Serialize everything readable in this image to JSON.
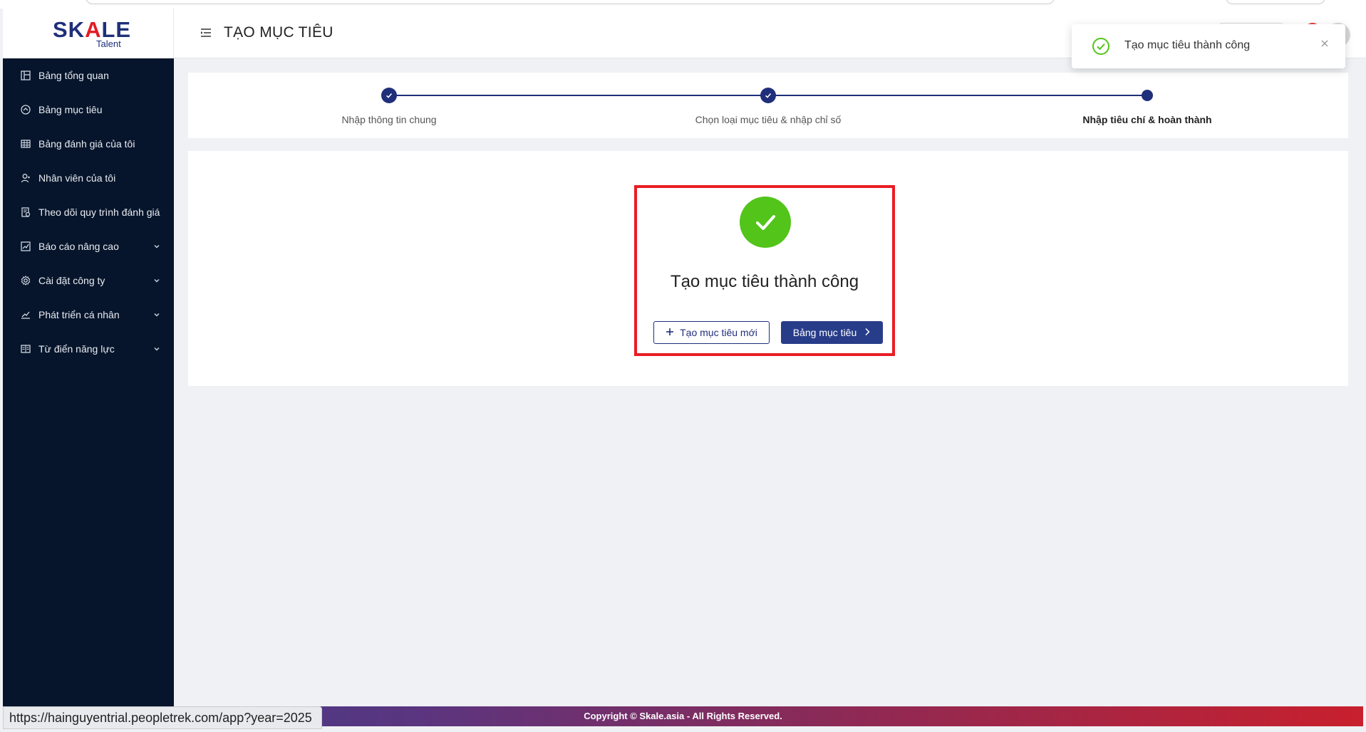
{
  "app": {
    "brand_main": "SK",
    "brand_a": "A",
    "brand_rest": "LE",
    "brand_sub": "Talent",
    "page_title": "TẠO MỤC TIÊU"
  },
  "sidebar": {
    "items": [
      {
        "label": "Bảng tổng quan",
        "icon": "dashboard-icon",
        "expandable": false
      },
      {
        "label": "Bảng mục tiêu",
        "icon": "target-icon",
        "expandable": false
      },
      {
        "label": "Bảng đánh giá của tôi",
        "icon": "table-icon",
        "expandable": false
      },
      {
        "label": "Nhân viên của tôi",
        "icon": "users-icon",
        "expandable": false
      },
      {
        "label": "Theo dõi quy trình đánh giá",
        "icon": "tracking-icon",
        "expandable": false
      },
      {
        "label": "Báo cáo nâng cao",
        "icon": "chart-icon",
        "expandable": true
      },
      {
        "label": "Cài đặt công ty",
        "icon": "gear-icon",
        "expandable": true
      },
      {
        "label": "Phát triển cá nhân",
        "icon": "growth-icon",
        "expandable": true
      },
      {
        "label": "Từ điển năng lực",
        "icon": "book-icon",
        "expandable": true
      }
    ]
  },
  "stepper": {
    "steps": [
      {
        "label": "Nhập thông tin chung",
        "state": "done"
      },
      {
        "label": "Chọn loại mục tiêu & nhập chỉ số",
        "state": "done"
      },
      {
        "label": "Nhập tiêu chí & hoàn thành",
        "state": "active"
      }
    ]
  },
  "result": {
    "title": "Tạo mục tiêu thành công",
    "new_goal_label": "Tạo mục tiêu mới",
    "goal_board_label": "Bảng mục tiêu"
  },
  "toast": {
    "message": "Tạo mục tiêu thành công"
  },
  "footer": {
    "copyright": "Copyright © Skale.asia - All Rights Reserved."
  },
  "status_url": "https://hainguyentrial.peopletrek.com/app?year=2025",
  "colors": {
    "primary": "#1f2f7a",
    "sidebar_bg": "#06152b",
    "success": "#52c41a",
    "highlight": "#ea1c24"
  }
}
